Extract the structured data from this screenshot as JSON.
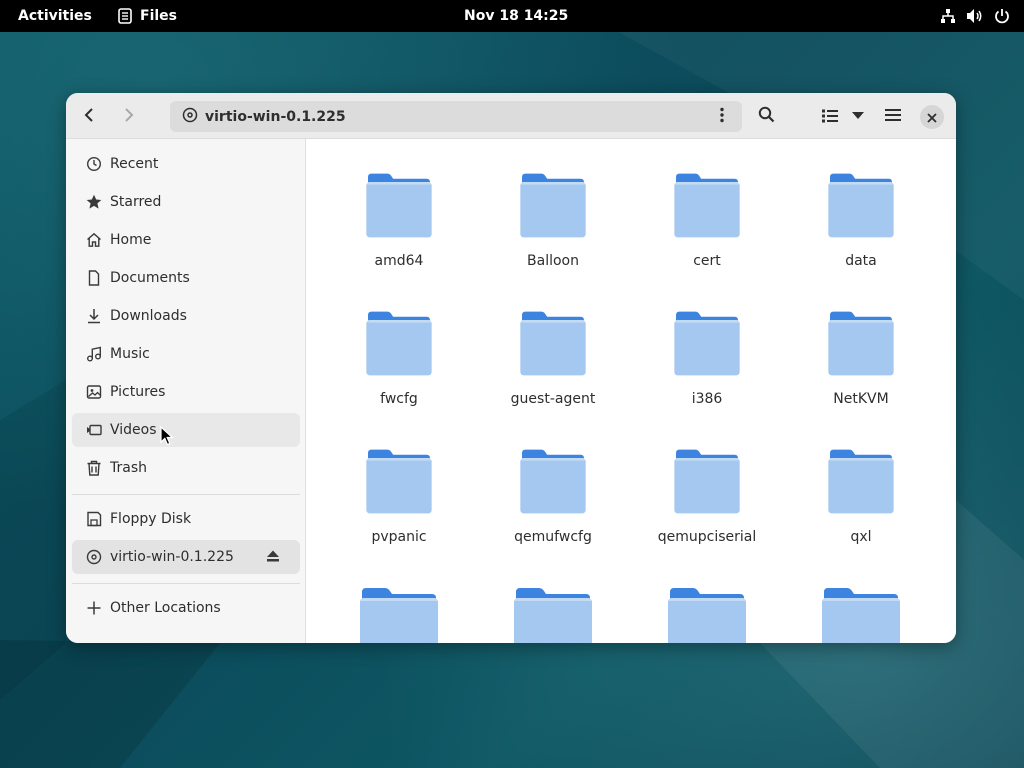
{
  "topbar": {
    "activities": "Activities",
    "app_name": "Files",
    "clock": "Nov 18  14:25"
  },
  "window": {
    "path": "virtio-win-0.1.225",
    "icons": [
      "back-icon",
      "forward-icon",
      "disc-icon",
      "kebab-icon",
      "search-icon",
      "list-view-icon",
      "dropdown-icon",
      "hamburger-menu-icon",
      "close-icon"
    ]
  },
  "sidebar": {
    "places": [
      {
        "label": "Recent",
        "icon": "clock-icon"
      },
      {
        "label": "Starred",
        "icon": "star-icon"
      },
      {
        "label": "Home",
        "icon": "home-icon"
      },
      {
        "label": "Documents",
        "icon": "document-icon"
      },
      {
        "label": "Downloads",
        "icon": "download-icon"
      },
      {
        "label": "Music",
        "icon": "music-icon"
      },
      {
        "label": "Pictures",
        "icon": "picture-icon"
      },
      {
        "label": "Videos",
        "icon": "video-icon"
      },
      {
        "label": "Trash",
        "icon": "trash-icon"
      }
    ],
    "devices": [
      {
        "label": "Floppy Disk",
        "icon": "floppy-icon"
      },
      {
        "label": "virtio-win-0.1.225",
        "icon": "disc-icon"
      }
    ],
    "other": {
      "label": "Other Locations",
      "icon": "plus-icon"
    }
  },
  "content": {
    "folders": [
      "amd64",
      "Balloon",
      "cert",
      "data",
      "fwcfg",
      "guest-agent",
      "i386",
      "NetKVM",
      "pvpanic",
      "qemufwcfg",
      "qemupciserial",
      "qxl",
      "",
      "",
      "",
      ""
    ]
  },
  "colors": {
    "folder_top": "#3d84e0",
    "folder_body": "#a4c8ef",
    "desktop": "#0d5a67"
  }
}
